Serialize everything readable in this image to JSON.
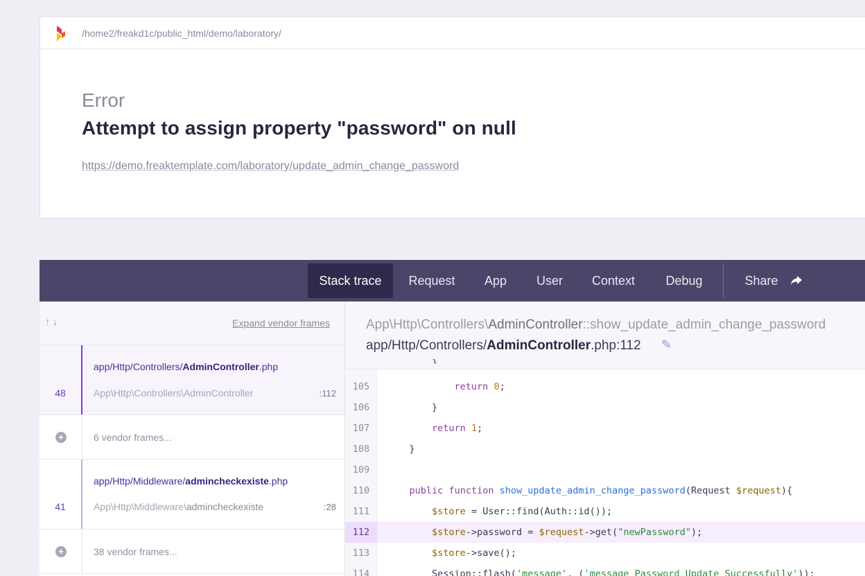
{
  "header": {
    "path": "/home2/freakd1c/public_html/demo/laboratory/",
    "error_class": "Error",
    "error_message": "Attempt to assign property \"password\" on null",
    "url": "https://demo.freaktemplate.com/laboratory/update_admin_change_password"
  },
  "tabs": [
    {
      "label": "Stack trace",
      "active": true
    },
    {
      "label": "Request"
    },
    {
      "label": "App"
    },
    {
      "label": "User"
    },
    {
      "label": "Context"
    },
    {
      "label": "Debug"
    },
    {
      "label": "Share"
    }
  ],
  "sidebar": {
    "expand_label": "Expand vendor frames",
    "frames": [
      {
        "number": "48",
        "file_prefix": "app/Http/Controllers/",
        "file_name": "AdminController",
        "file_ext": ".php",
        "class": "App\\Http\\Controllers\\AdminController",
        "line": ":112"
      },
      {
        "vendor": "6 vendor frames..."
      },
      {
        "number": "41",
        "file_prefix": "app/Http/Middleware/",
        "file_name": "admincheckexiste",
        "file_ext": ".php",
        "class_prefix": "App\\Http\\Middleware\\",
        "class_name": "admincheckexiste",
        "line": ":28"
      },
      {
        "vendor": "38 vendor frames..."
      }
    ]
  },
  "main": {
    "method_prefix": "App\\Http\\Controllers\\",
    "method_class": "AdminController",
    "method_name": "::show_update_admin_change_password",
    "file_prefix": "app/Http/Controllers/",
    "file_name": "AdminController",
    "file_suffix": ".php:112",
    "line_numbers": [
      "105",
      "106",
      "107",
      "108",
      "109",
      "110",
      "111",
      "112",
      "113",
      "114"
    ],
    "highlight_line": "112"
  },
  "colors": {
    "tabbar": "#4b4669",
    "active_tab": "#2e2a4b",
    "accent": "#7e3bd0"
  }
}
